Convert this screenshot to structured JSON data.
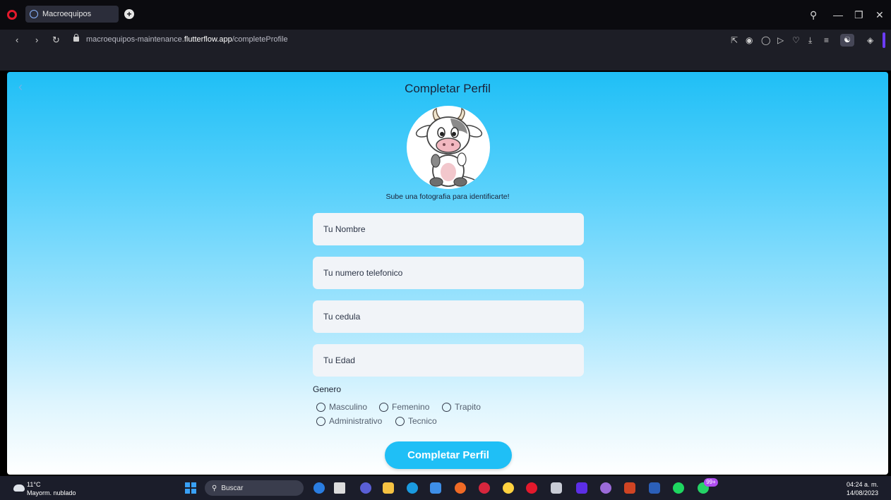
{
  "browser": {
    "tab_title": "Macroequipos",
    "url_prefix": "macroequipos-maintenance.",
    "url_domain": "flutterflow.app",
    "url_path": "/completeProfile"
  },
  "app": {
    "page_title": "Completar Perfil",
    "avatar_caption": "Sube una fotografia para identificarte!",
    "fields": [
      {
        "placeholder": "Tu Nombre"
      },
      {
        "placeholder": "Tu numero telefonico"
      },
      {
        "placeholder": "Tu cedula"
      },
      {
        "placeholder": "Tu Edad"
      }
    ],
    "gender_label": "Genero",
    "gender_options": [
      "Masculino",
      "Femenino",
      "Trapito",
      "Administrativo",
      "Tecnico"
    ],
    "submit_label": "Completar Perfil",
    "colors": {
      "accent": "#1fbff6",
      "field_bg": "#f1f4f8"
    }
  },
  "taskbar": {
    "weather_temp": "11°C",
    "weather_desc": "Mayorm. nublado",
    "search_label": "Buscar",
    "notification_badge": "99+",
    "time": "04:24 a. m.",
    "date": "14/08/2023"
  }
}
